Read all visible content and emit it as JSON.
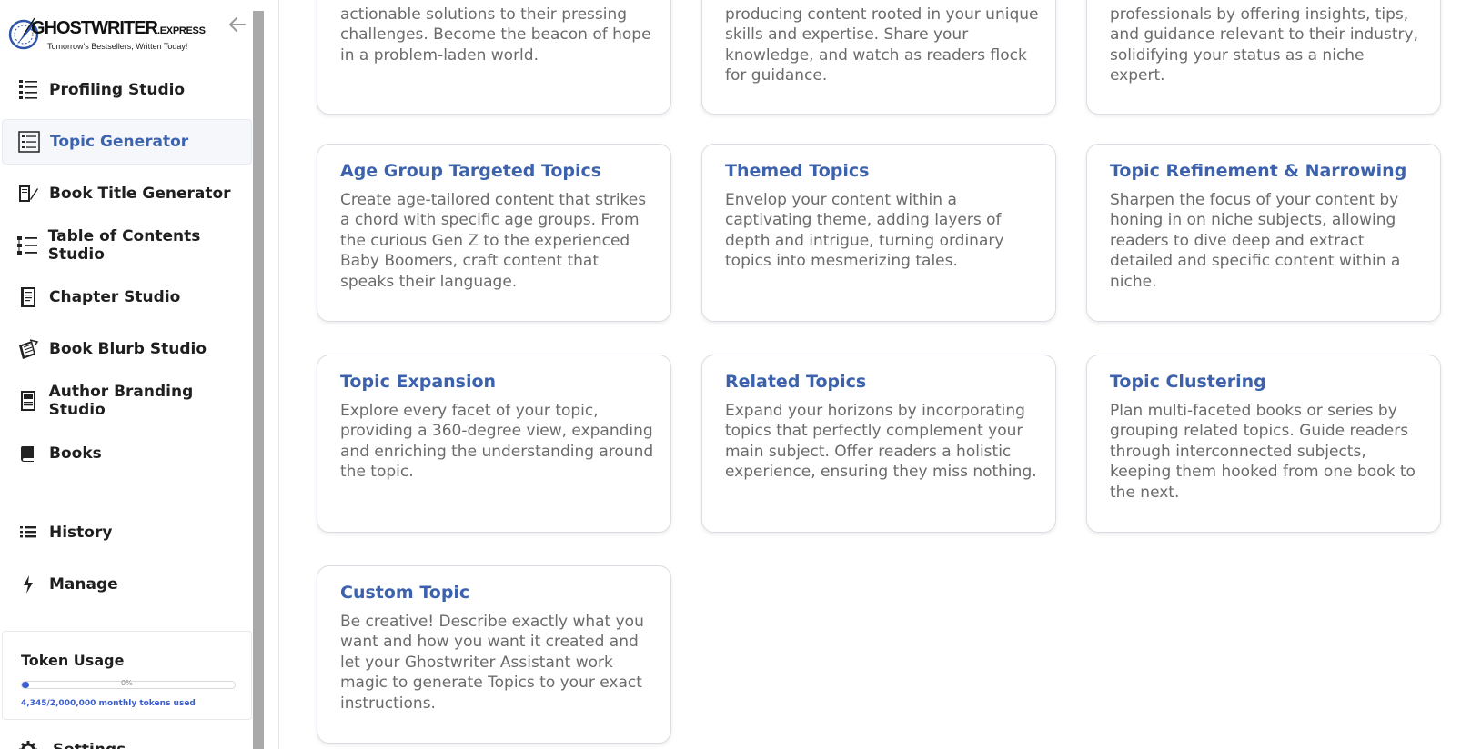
{
  "brand": {
    "name": "GHOSTWRITER",
    "suffix": ".EXPRESS",
    "tagline": "Tomorrow's Bestsellers, Written Today!"
  },
  "sidebar": {
    "items": [
      {
        "label": "Profiling Studio",
        "icon": "profiling-list-icon"
      },
      {
        "label": "Topic Generator",
        "icon": "topic-list-icon",
        "active": true
      },
      {
        "label": "Book Title Generator",
        "icon": "book-pen-icon"
      },
      {
        "label": "Table of Contents Studio",
        "icon": "toc-list-icon"
      },
      {
        "label": "Chapter Studio",
        "icon": "notebook-icon"
      },
      {
        "label": "Book Blurb Studio",
        "icon": "books-stack-icon"
      },
      {
        "label": "Author Branding Studio",
        "icon": "id-card-icon"
      },
      {
        "label": "Books",
        "icon": "book-icon"
      }
    ],
    "secondary": [
      {
        "label": "History",
        "icon": "list-icon"
      },
      {
        "label": "Manage",
        "icon": "bolt-icon"
      }
    ],
    "token_usage": {
      "title": "Token Usage",
      "percent_label": "0%",
      "fraction": 0.002,
      "detail": "4,345/2,000,000 monthly tokens used"
    },
    "settings_label": "Settings"
  },
  "cards_partial": [
    {
      "desc": "actionable solutions to their pressing challenges. Become the beacon of hope in a problem-laden world."
    },
    {
      "desc": "producing content rooted in your unique skills and expertise. Share your knowledge, and watch as readers flock for guidance."
    },
    {
      "desc": "professionals by offering insights, tips, and guidance relevant to their industry, solidifying your status as a niche expert."
    }
  ],
  "cards": [
    {
      "title": "Age Group Targeted Topics",
      "desc": "Create age-tailored content that strikes a chord with specific age groups. From the curious Gen Z to the experienced Baby Boomers, craft content that speaks their language."
    },
    {
      "title": "Themed Topics",
      "desc": "Envelop your content within a captivating theme, adding layers of depth and intrigue, turning ordinary topics into mesmerizing tales."
    },
    {
      "title": "Topic Refinement & Narrowing",
      "desc": "Sharpen the focus of your content by honing in on niche subjects, allowing readers to dive deep and extract detailed and specific content within a niche."
    },
    {
      "title": "Topic Expansion",
      "desc": "Explore every facet of your topic, providing a 360-degree view, expanding and enriching the understanding around the topic."
    },
    {
      "title": "Related Topics",
      "desc": "Expand your horizons by incorporating topics that perfectly complement your main subject. Offer readers a holistic experience, ensuring they miss nothing."
    },
    {
      "title": "Topic Clustering",
      "desc": "Plan multi-faceted books or series by grouping related topics. Guide readers through interconnected subjects, keeping them hooked from one book to the next."
    },
    {
      "title": "Custom Topic",
      "desc": "Be creative! Describe exactly what you want and how you want it created and let your Ghostwriter Assistant work magic to generate Topics to your exact instructions."
    }
  ]
}
